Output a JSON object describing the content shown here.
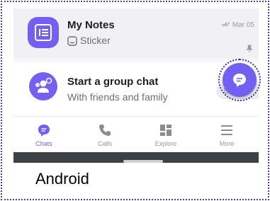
{
  "chats": [
    {
      "title": "My Notes",
      "subtitle": "Sticker",
      "date": "Mar 05",
      "subtitle_icon": "sticker-icon",
      "avatar_icon": "notes-list-icon"
    },
    {
      "title": "Start a group chat",
      "subtitle": "With friends and family",
      "tag": "Start",
      "avatar_icon": "group-icon"
    }
  ],
  "fab": {
    "icon": "new-chat-icon"
  },
  "nav": {
    "items": [
      {
        "label": "Chats",
        "icon": "chat-bubble-icon",
        "active": true
      },
      {
        "label": "Calls",
        "icon": "phone-icon"
      },
      {
        "label": "Explore",
        "icon": "grid-icon"
      },
      {
        "label": "More",
        "icon": "menu-icon"
      }
    ]
  },
  "caption": "Android",
  "colors": {
    "accent": "#7360f2",
    "system_bar": "#3d4143",
    "frame": "#4b3fa8"
  }
}
